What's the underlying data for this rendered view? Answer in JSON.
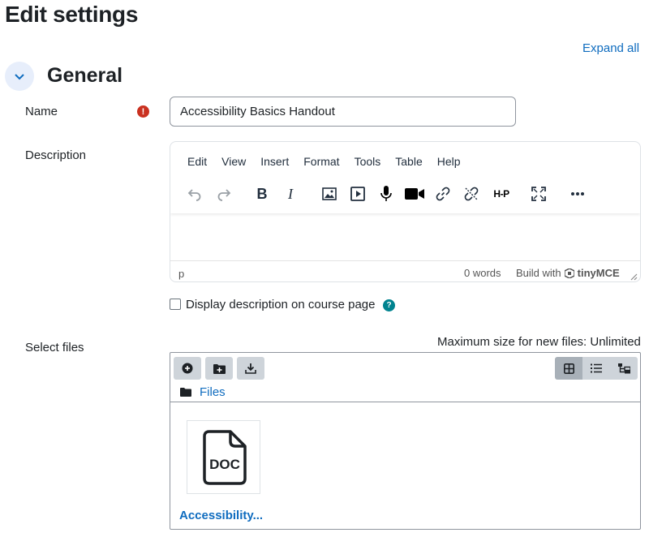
{
  "page": {
    "title": "Edit settings",
    "expand_all": "Expand all"
  },
  "section": {
    "title": "General"
  },
  "name_field": {
    "label": "Name",
    "value": "Accessibility Basics Handout",
    "required_icon": "exclamation-icon"
  },
  "description": {
    "label": "Description",
    "menu": [
      "Edit",
      "View",
      "Insert",
      "Format",
      "Tools",
      "Table",
      "Help"
    ],
    "toolbar_icons": [
      "undo-icon",
      "redo-icon",
      "bold-icon",
      "italic-icon",
      "image-icon",
      "media-icon",
      "microphone-icon",
      "video-camera-icon",
      "link-icon",
      "unlink-icon",
      "h5p-icon",
      "fullscreen-icon",
      "more-icon"
    ],
    "bold_glyph": "B",
    "italic_glyph": "I",
    "h5p_text": "H-P",
    "status_element": "p",
    "word_count": "0 words",
    "build_with": "Build with",
    "tinymce": "tinyMCE"
  },
  "display_description": {
    "label": "Display description on course page",
    "checked": false
  },
  "files": {
    "label": "Select files",
    "max_size": "Maximum size for new files: Unlimited",
    "path_root": "Files",
    "items": [
      {
        "name": "Accessibility...",
        "type_label": "DOC"
      }
    ]
  },
  "colors": {
    "link": "#0f6cbf",
    "required": "#ca3120",
    "help": "#00838f"
  }
}
